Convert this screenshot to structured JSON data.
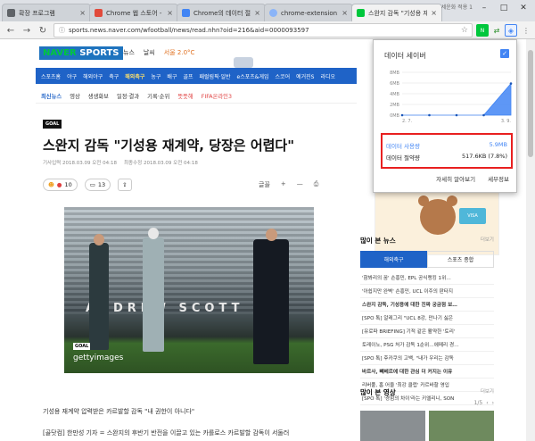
{
  "browser": {
    "tabs": [
      {
        "label": "확장 프로그램",
        "color": "#5f6368"
      },
      {
        "label": "Chrome 웹 스토어 - ",
        "color": "#e14a3b"
      },
      {
        "label": "Chrome의 데이터 절약",
        "color": "#4285f4"
      },
      {
        "label": "chrome-extension://pf",
        "color": "#4285f4"
      },
      {
        "label": "스완지 감독 \"기성용 재",
        "color": "#00c73c"
      }
    ],
    "window_label": "세운화 적용 1",
    "address": "sports.news.naver.com/wfootball/news/read.nhn?oid=216&aid=0000093597"
  },
  "site": {
    "logo_naver": "NAVER",
    "logo_sports": "SPORTS",
    "toplinks": [
      "뉴스",
      "날씨",
      "서울 2.0°C"
    ],
    "nav": [
      "스포츠홈",
      "야구",
      "해외야구",
      "축구",
      "해외축구",
      "농구",
      "배구",
      "골프",
      "패럴림픽·일반",
      "e스포츠&게임",
      "스코어",
      "예거진S",
      "라디오"
    ],
    "nav_selected": "해외축구",
    "subnav": [
      "최신뉴스",
      "영상",
      "생생화보",
      "일정·결과",
      "기록·순위",
      "뜻뜻해",
      "FIFA온라인3"
    ]
  },
  "article": {
    "badge": "GOAL",
    "headline": "스완지 감독 \"기성용 재계약, 당장은 어렵다\"",
    "meta_1": "기사입력 2018.03.09 오전 04:18",
    "meta_2": "최종수정 2018.03.09 오전 04:18",
    "likes": "10",
    "comments": "13",
    "font_label": "글꼴",
    "photo_banner": "ANDREW SCOTT",
    "photo_credit": "gettyimages",
    "photo_goal": "GOAL",
    "caption": "기성용 재계약 압력받은 카르발할 감독 \"내 권한이 아니다\"",
    "body": "[골닷컴] 한만성 기자 = 스완지의 후반기 반전을 이끌고 있는 카를로스 카르발할 감독이 서둘러"
  },
  "sidebar": {
    "ad_card": "VISA",
    "popular_title": "많이 본 뉴스",
    "more": "더보기",
    "tabs": [
      "해외축구",
      "스포츠 종합"
    ],
    "news": [
      "'함봐리의 꿈' 손흥민, EPL 공식랭킹 1위…",
      "'아쉽지만 완벽' 손흥민, UCL 이주의 판타지",
      "스완지 감독, 기성용에 대한 진짜 궁금점 보…",
      "[SPO 톡] 알레그리 \"UCL 8강, 만나기 싫은",
      "[유로파 BRIEFING] 기적 같은 활약한 '토리'",
      "토레이노, PSG 처가 감독 1순위…에메리 경…",
      "[SPO 톡] 후카쿠의 고백, \"내가 우리는 감독",
      "바르사, 빼베르에 대한 관심 더 커지는 이유",
      "리버풀, 홈 어울 '최강 클럽' 카르바할 영입",
      "[SPO 톡] '경험의 차이'라는 키엘리니, SON"
    ],
    "video_title": "많이 본 영상",
    "paging": "1/5"
  },
  "data_saver": {
    "title": "데이터 세이버",
    "y_labels": [
      "8MB",
      "6MB",
      "4MB",
      "2MB",
      "0MB"
    ],
    "x_labels": [
      "2. 7.",
      "3. 9."
    ],
    "usage_label": "데이터 사용량",
    "usage_value": "5.9MB",
    "savings_label": "데이터 절약량",
    "savings_value": "517.6KB (7.8%)",
    "learn_more": "자세히 알아보기",
    "details": "세부정보"
  },
  "chart_data": {
    "type": "area",
    "x": [
      "2. 7.",
      "3. 9."
    ],
    "values": [
      0,
      0,
      0,
      0,
      5.9
    ],
    "ylim": [
      0,
      8
    ],
    "ylabel": "",
    "xlabel": "",
    "color": "#4285f4"
  }
}
